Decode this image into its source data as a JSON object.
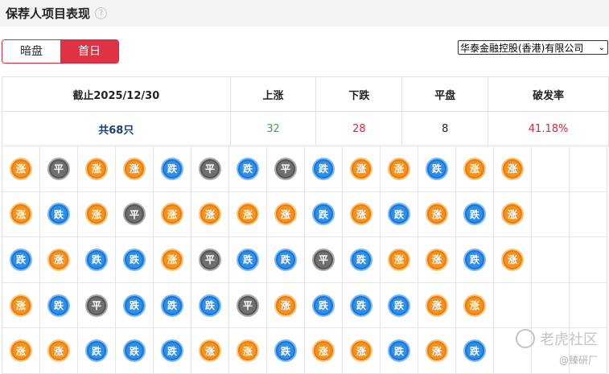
{
  "header": {
    "title": "保荐人项目表现",
    "help_icon": "question-circle-icon"
  },
  "toggle": {
    "left": "暗盘",
    "right": "首日",
    "selected": "首日"
  },
  "select": {
    "value": "华泰金融控股(香港)有限公司"
  },
  "summary": {
    "headers": [
      "截止2025/12/30",
      "上涨",
      "下跌",
      "平盘",
      "破发率"
    ],
    "total": "共68只",
    "up": "32",
    "down": "28",
    "flat": "8",
    "break_rate": "41.18%"
  },
  "colors": {
    "up": "#f49321",
    "down": "#2e8ee8",
    "flat": "#6f6f6f",
    "red": "#d8283a",
    "green": "#3aa74a"
  },
  "grid": [
    [
      "涨",
      "平",
      "涨",
      "涨",
      "跌",
      "平",
      "跌",
      "平",
      "跌",
      "涨",
      "涨",
      "跌",
      "涨",
      "涨"
    ],
    [
      "涨",
      "跌",
      "涨",
      "平",
      "涨",
      "涨",
      "涨",
      "涨",
      "跌",
      "涨",
      "跌",
      "涨",
      "跌",
      "涨"
    ],
    [
      "跌",
      "涨",
      "跌",
      "跌",
      "涨",
      "平",
      "跌",
      "跌",
      "平",
      "跌",
      "涨",
      "涨",
      "跌",
      "涨"
    ],
    [
      "涨",
      "跌",
      "平",
      "跌",
      "跌",
      "跌",
      "平",
      "涨",
      "跌",
      "跌",
      "跌",
      "涨",
      "涨"
    ],
    [
      "涨",
      "涨",
      "跌",
      "跌",
      "跌",
      "涨",
      "涨",
      "跌",
      "涨",
      "涨",
      "跌",
      "涨",
      "跌"
    ]
  ],
  "watermark": {
    "main": "老虎社区",
    "sub": "@臻研厂"
  }
}
